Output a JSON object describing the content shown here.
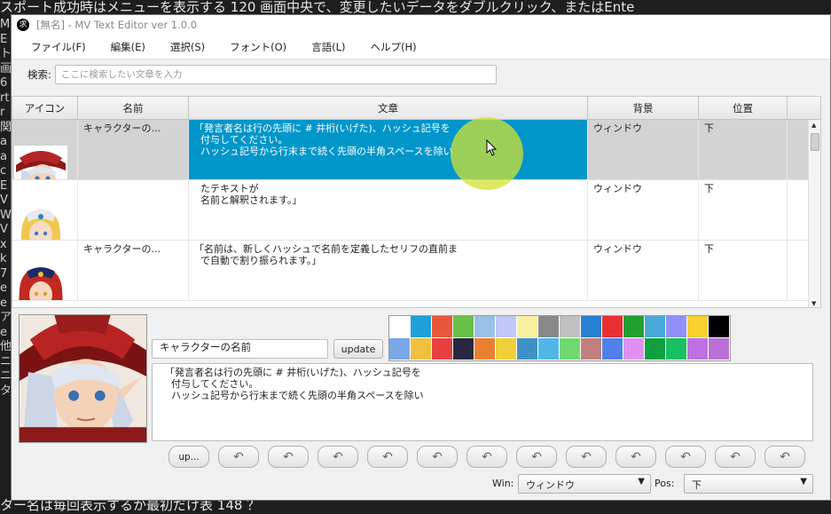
{
  "bg": {
    "top_line": "スポート成功時はメニューを表示する 120 画面中央で、変更したいデータをダブルクリック、またはEnte",
    "bottom_line": "ター名は毎回表示するか最初だけ表 148 ？",
    "side_chars": "MEト画6rtr関aacEVWVxk7eeアe他ニニタ"
  },
  "window": {
    "title": "[無名] - MV Text Editor ver 1.0.0",
    "app_icon_glyph": "求"
  },
  "menu": [
    "ファイル(F)",
    "編集(E)",
    "選択(S)",
    "フォント(O)",
    "言語(L)",
    "ヘルプ(H)"
  ],
  "search": {
    "label": "検索:",
    "placeholder": "ここに検索したい文章を入力"
  },
  "table": {
    "columns": [
      "アイコン",
      "名前",
      "文章",
      "背景",
      "位置"
    ],
    "rows": [
      {
        "icon": "red-hat-elf-portrait",
        "name": "キャラクターの...",
        "text": "「発言者名は行の先頭に # 井桁(いげた)、ハッシュ記号を\n  付与してください。\n  ハッシュ記号から行末まで続く先頭の半角スペースを除い",
        "bg": "ウィンドウ",
        "pos": "下",
        "selected": true
      },
      {
        "icon": "blonde-knight-portrait",
        "name": "",
        "text": "  たテキストが\n  名前と解釈されます。」",
        "bg": "ウィンドウ",
        "pos": "下",
        "selected": false
      },
      {
        "icon": "red-hair-elf-portrait",
        "name": "キャラクターの...",
        "text": "「名前は、新しくハッシュで名前を定義したセリフの直前ま\n  で自動で割り振られます。」",
        "bg": "ウィンドウ",
        "pos": "下",
        "selected": false
      }
    ]
  },
  "editor": {
    "name_value": "キャラクターの名前",
    "update_label": "update",
    "message": "「発言者名は行の先頭に # 井桁(いげた)、ハッシュ記号を\n  付与してください。\n  ハッシュ記号から行末まで続く先頭の半角スペースを除い",
    "up_label": "up...",
    "face_buttons": 12,
    "win_label": "Win:",
    "win_value": "ウィンドウ",
    "pos_label": "Pos:",
    "pos_value": "下"
  },
  "palette": [
    "#ffffff",
    "#20a0d8",
    "#e85838",
    "#68c048",
    "#98c0e8",
    "#c0c8f8",
    "#f8f0a0",
    "#888888",
    "#c0c0c0",
    "#2880d0",
    "#e83030",
    "#20a030",
    "#48a8d8",
    "#9090f8",
    "#f8d030",
    "#000000",
    "#78a8e8",
    "#f0c040",
    "#e84040",
    "#282840",
    "#e88030",
    "#f0d038",
    "#4090c8",
    "#50b8e8",
    "#70d870",
    "#c08080",
    "#5080e8",
    "#e090f0",
    "#10a040",
    "#18c060",
    "#c070e0",
    "#b870d8"
  ],
  "colors": {
    "selection": "#0096c9",
    "cursor_highlight": "#d2e132"
  }
}
